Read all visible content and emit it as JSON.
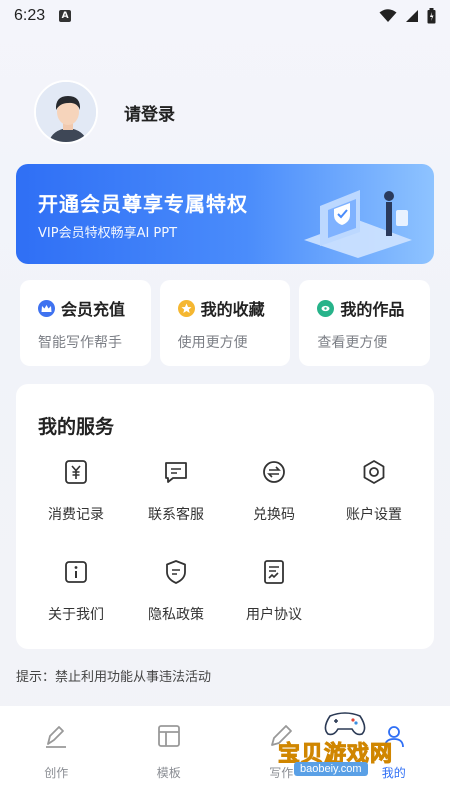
{
  "status_bar": {
    "time": "6:23",
    "notif_letter": "A"
  },
  "profile": {
    "login_label": "请登录"
  },
  "vip_banner": {
    "title": "开通会员尊享专属特权",
    "subtitle": "VIP会员特权畅享AI PPT"
  },
  "quick_cards": [
    {
      "title": "会员充值",
      "subtitle": "智能写作帮手",
      "icon": "crown-icon",
      "color": "#3f72f0"
    },
    {
      "title": "我的收藏",
      "subtitle": "使用更方便",
      "icon": "star-icon",
      "color": "#f5b731"
    },
    {
      "title": "我的作品",
      "subtitle": "查看更方便",
      "icon": "works-icon",
      "color": "#27b38a"
    }
  ],
  "services": {
    "title": "我的服务",
    "items": [
      {
        "label": "消费记录",
        "icon": "receipt-icon"
      },
      {
        "label": "联系客服",
        "icon": "chat-icon"
      },
      {
        "label": "兑换码",
        "icon": "exchange-icon"
      },
      {
        "label": "账户设置",
        "icon": "gear-icon"
      },
      {
        "label": "关于我们",
        "icon": "info-icon"
      },
      {
        "label": "隐私政策",
        "icon": "shield-icon"
      },
      {
        "label": "用户协议",
        "icon": "document-icon"
      }
    ]
  },
  "tip": "提示：禁止利用功能从事违法活动",
  "bottom_nav": [
    {
      "label": "创作",
      "icon": "pen-icon"
    },
    {
      "label": "模板",
      "icon": "template-icon"
    },
    {
      "label": "写作",
      "icon": "write-icon"
    },
    {
      "label": "我的",
      "icon": "profile-icon"
    }
  ],
  "watermark": {
    "text": "宝贝游戏网",
    "url": "baobeiy.com"
  }
}
